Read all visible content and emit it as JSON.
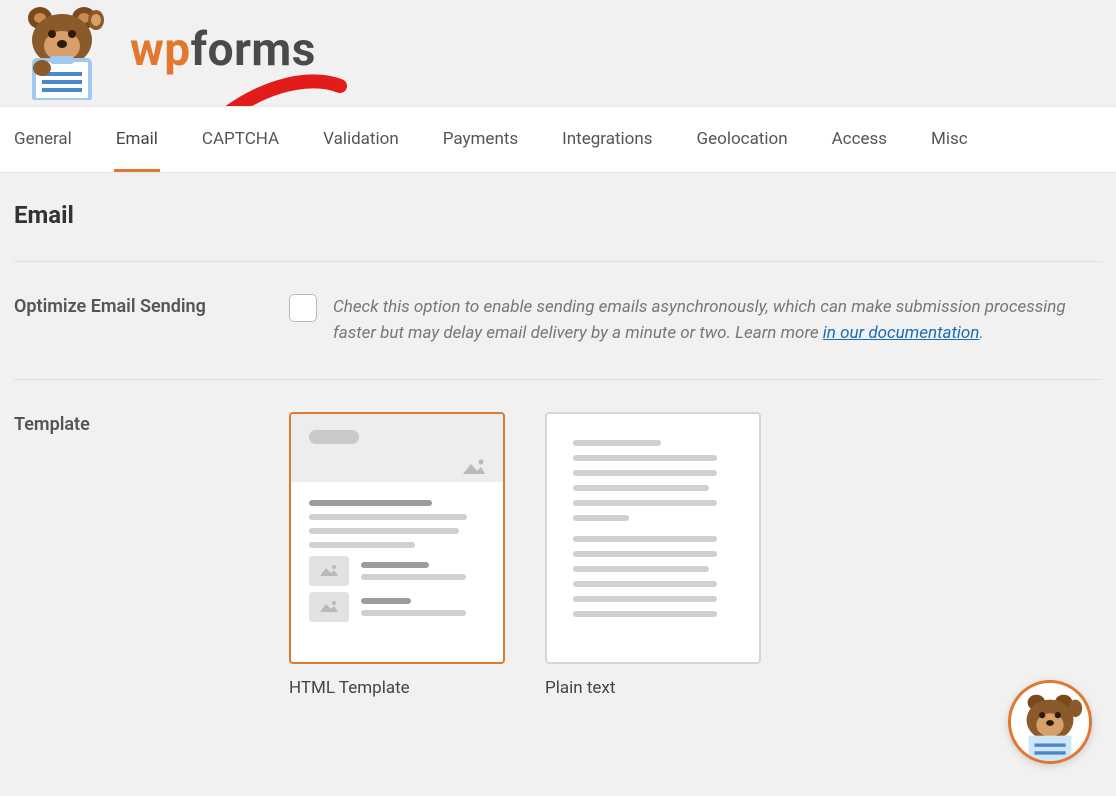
{
  "brand": {
    "wp": "wp",
    "forms": "forms"
  },
  "tabs": [
    {
      "label": "General",
      "active": false
    },
    {
      "label": "Email",
      "active": true
    },
    {
      "label": "CAPTCHA",
      "active": false
    },
    {
      "label": "Validation",
      "active": false
    },
    {
      "label": "Payments",
      "active": false
    },
    {
      "label": "Integrations",
      "active": false
    },
    {
      "label": "Geolocation",
      "active": false
    },
    {
      "label": "Access",
      "active": false
    },
    {
      "label": "Misc",
      "active": false
    }
  ],
  "section_title": "Email",
  "optimize": {
    "label": "Optimize Email Sending",
    "desc_prefix": "Check this option to enable sending emails asynchronously, which can make submission processing faster but may delay email delivery by a minute or two. Learn more ",
    "link_text": "in our documentation",
    "desc_suffix": "."
  },
  "template": {
    "label": "Template",
    "options": [
      {
        "label": "HTML Template",
        "selected": true
      },
      {
        "label": "Plain text",
        "selected": false
      }
    ]
  }
}
